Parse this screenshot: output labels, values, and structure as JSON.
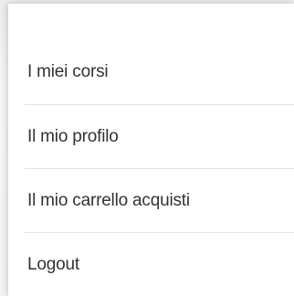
{
  "user_menu": {
    "items": [
      {
        "label": "I miei corsi"
      },
      {
        "label": "Il mio profilo"
      },
      {
        "label": "Il mio carrello acquisti"
      },
      {
        "label": "Logout"
      }
    ]
  }
}
